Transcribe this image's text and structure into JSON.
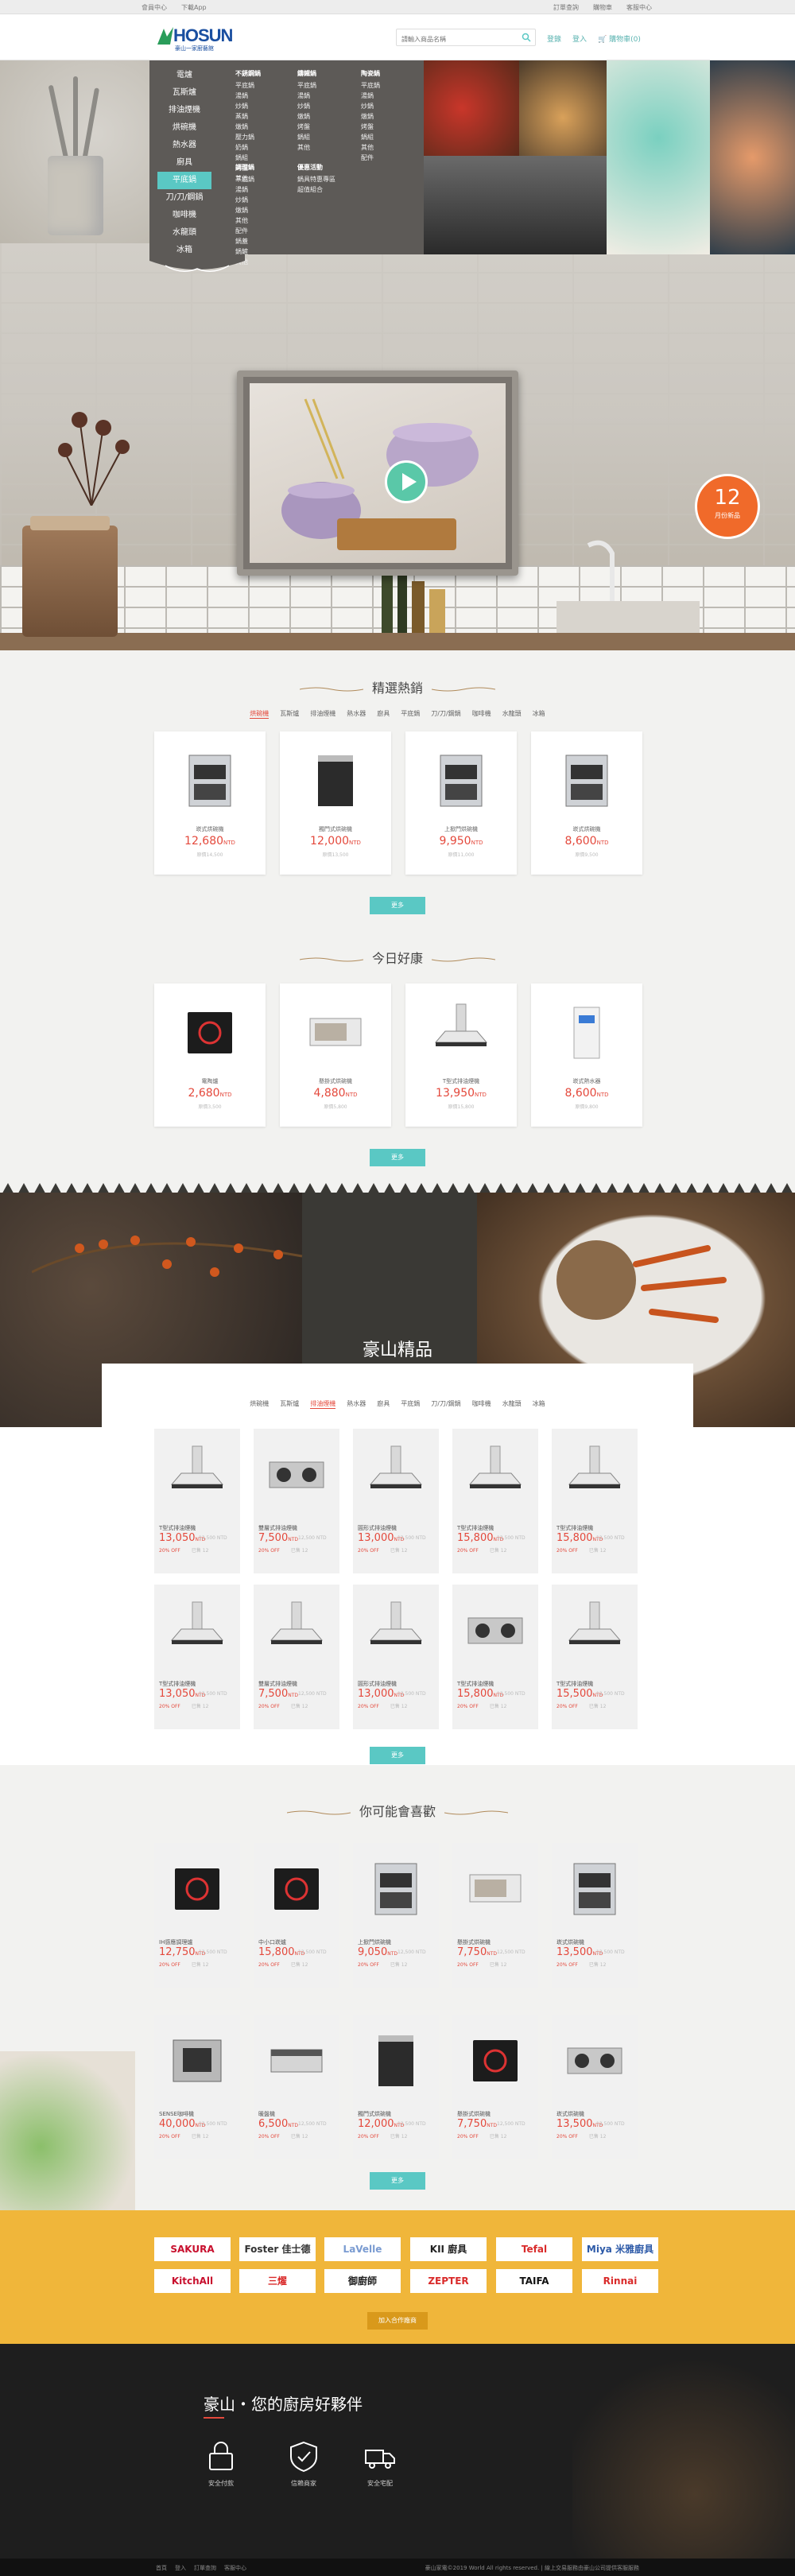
{
  "topbar": {
    "left": [
      "會員中心",
      "下載App"
    ],
    "right": [
      "訂單查詢",
      "購物車",
      "客服中心"
    ]
  },
  "header": {
    "logo_word": "HOSUN",
    "logo_sub": "豪山一家廚藝館",
    "search_placeholder": "請輸入商品名稱",
    "links": [
      "登錄",
      "登入",
      "購物車(0)"
    ]
  },
  "menu": {
    "left": [
      "電爐",
      "瓦斯爐",
      "排油煙機",
      "烘碗機",
      "熱水器",
      "廚具",
      "平底鍋",
      "刀/刀/鋼鍋",
      "咖啡機",
      "水龍頭",
      "冰箱"
    ],
    "active": 6,
    "col1_title": "不銹鋼鍋",
    "col1": [
      "平底鍋",
      "湯鍋",
      "炒鍋",
      "蒸鍋",
      "燉鍋",
      "壓力鍋",
      "奶鍋",
      "鍋組",
      "烤盤",
      "其他"
    ],
    "col2_title": "鑄鐵鍋",
    "col2": [
      "平底鍋",
      "湯鍋",
      "炒鍋",
      "燉鍋",
      "烤盤",
      "鍋組",
      "其他"
    ],
    "col3_title": "陶瓷鍋",
    "col3": [
      "平底鍋",
      "湯鍋",
      "炒鍋",
      "燉鍋",
      "烤盤",
      "鍋組",
      "其他",
      "配件"
    ],
    "col4_title": "調理鍋",
    "col4": [
      "平底鍋",
      "湯鍋",
      "炒鍋",
      "燉鍋",
      "其他",
      "配件",
      "鍋蓋",
      "鍋鏟",
      "其他"
    ],
    "col5_title": "優惠活動",
    "col5": [
      "鍋具特惠專區",
      "超值組合"
    ]
  },
  "badge": {
    "number": "12",
    "text": "月份新品"
  },
  "sections": {
    "featured": {
      "title": "精選熱銷",
      "tabs": [
        "烘碗機",
        "瓦斯爐",
        "排油煙機",
        "熱水器",
        "廚具",
        "平底鍋",
        "刀/刀/鋼鍋",
        "咖啡機",
        "水龍頭",
        "冰箱"
      ],
      "active": 0,
      "items": [
        {
          "name": "崁式烘碗機",
          "price": "12,680",
          "orig": "原價14,500"
        },
        {
          "name": "獨門式烘碗機",
          "price": "12,000",
          "orig": "原價13,500"
        },
        {
          "name": "上掀門烘碗機",
          "price": "9,950",
          "orig": "原價11,000"
        },
        {
          "name": "崁式烘碗機",
          "price": "8,600",
          "orig": "原價9,500"
        }
      ],
      "more": "更多"
    },
    "today": {
      "title": "今日好康",
      "items": [
        {
          "name": "電陶爐",
          "price": "2,680",
          "orig": "原價3,500"
        },
        {
          "name": "懸掛式烘碗機",
          "price": "4,880",
          "orig": "原價5,800"
        },
        {
          "name": "T型式排油煙機",
          "price": "13,950",
          "orig": "原價15,800"
        },
        {
          "name": "崁式熱水器",
          "price": "8,600",
          "orig": "原價9,800"
        }
      ],
      "more": "更多"
    },
    "premium": {
      "title": "豪山精品",
      "tabs": [
        "烘碗機",
        "瓦斯爐",
        "排油煙機",
        "熱水器",
        "廚具",
        "平底鍋",
        "刀/刀/鋼鍋",
        "咖啡機",
        "水龍頭",
        "冰箱"
      ],
      "active": 2,
      "items": [
        {
          "name": "T型式排油煙機",
          "price": "13,050",
          "orig": "12,500 NTD",
          "save": "20% OFF",
          "sold": "已售 12"
        },
        {
          "name": "雙層式排油煙機",
          "price": "7,500",
          "orig": "12,500 NTD",
          "save": "20% OFF",
          "sold": "已售 12"
        },
        {
          "name": "圓形式排油煙機",
          "price": "13,000",
          "orig": "12,500 NTD",
          "save": "20% OFF",
          "sold": "已售 12"
        },
        {
          "name": "T型式排油煙機",
          "price": "15,800",
          "orig": "12,500 NTD",
          "save": "20% OFF",
          "sold": "已售 12"
        },
        {
          "name": "T型式排油煙機",
          "price": "15,800",
          "orig": "12,500 NTD",
          "save": "20% OFF",
          "sold": "已售 12"
        },
        {
          "name": "T型式排油煙機",
          "price": "13,050",
          "orig": "12,500 NTD",
          "save": "20% OFF",
          "sold": "已售 12"
        },
        {
          "name": "雙層式排油煙機",
          "price": "7,500",
          "orig": "12,500 NTD",
          "save": "20% OFF",
          "sold": "已售 12"
        },
        {
          "name": "圓形式排油煙機",
          "price": "13,000",
          "orig": "12,500 NTD",
          "save": "20% OFF",
          "sold": "已售 12"
        },
        {
          "name": "T型式排油煙機",
          "price": "15,800",
          "orig": "12,500 NTD",
          "save": "20% OFF",
          "sold": "已售 12"
        },
        {
          "name": "T型式排油煙機",
          "price": "15,500",
          "orig": "12,500 NTD",
          "save": "20% OFF",
          "sold": "已售 12"
        }
      ],
      "more": "更多"
    },
    "maylike": {
      "title": "你可能會喜歡",
      "items": [
        {
          "name": "IH感應調理爐",
          "price": "12,750",
          "orig": "12,500 NTD",
          "save": "20% OFF",
          "sold": "已售 12"
        },
        {
          "name": "中小口崁爐",
          "price": "15,800",
          "orig": "12,500 NTD",
          "save": "20% OFF",
          "sold": "已售 12"
        },
        {
          "name": "上掀門烘碗機",
          "price": "9,050",
          "orig": "12,500 NTD",
          "save": "20% OFF",
          "sold": "已售 12"
        },
        {
          "name": "懸掛式烘碗機",
          "price": "7,750",
          "orig": "12,500 NTD",
          "save": "20% OFF",
          "sold": "已售 12"
        },
        {
          "name": "崁式烘碗機",
          "price": "13,500",
          "orig": "12,500 NTD",
          "save": "20% OFF",
          "sold": "已售 12"
        },
        {
          "name": "SENSE咖啡機",
          "price": "40,000",
          "orig": "12,500 NTD",
          "save": "20% OFF",
          "sold": "已售 12"
        },
        {
          "name": "暖盤機",
          "price": "6,500",
          "orig": "12,500 NTD",
          "save": "20% OFF",
          "sold": "已售 12"
        },
        {
          "name": "獨門式烘碗機",
          "price": "12,000",
          "orig": "12,500 NTD",
          "save": "20% OFF",
          "sold": "已售 12"
        },
        {
          "name": "懸掛式烘碗機",
          "price": "7,750",
          "orig": "12,500 NTD",
          "save": "20% OFF",
          "sold": "已售 12"
        },
        {
          "name": "崁式烘碗機",
          "price": "13,500",
          "orig": "12,500 NTD",
          "save": "20% OFF",
          "sold": "已售 12"
        }
      ],
      "more": "更多"
    }
  },
  "currency": "NTD",
  "brands": {
    "row1": [
      "SAKURA",
      "Foster 佳士德",
      "LaVelle",
      "KII 廚具",
      "Tefal",
      "Miya 米雅廚具"
    ],
    "row2": [
      "KitchAll",
      "三燿",
      "御廚師",
      "ZEPTER",
      "TAIFA",
      "Rinnai"
    ],
    "cta": "加入合作廠商"
  },
  "footer": {
    "heading": "豪山・您的廚房好夥伴",
    "features": [
      "安全付款",
      "信賴商家",
      "安全宅配"
    ],
    "links": [
      "首頁",
      "登入",
      "訂單查詢",
      "客服中心"
    ],
    "copyright": "豪山家電©2019 World All rights reserved. | 線上交易服務由豪山公司提供客服服務"
  },
  "colors": {
    "accent": "#5ac8c4",
    "price": "#e4493c",
    "brand_band": "#f0b63a",
    "footer": "#1e1e1e"
  }
}
